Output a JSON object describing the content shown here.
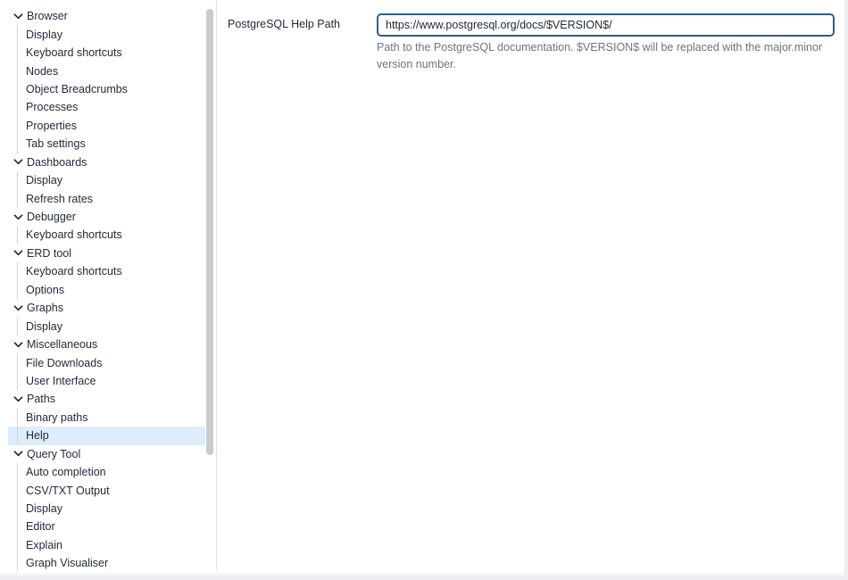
{
  "tree": [
    {
      "label": "Browser",
      "children": [
        "Display",
        "Keyboard shortcuts",
        "Nodes",
        "Object Breadcrumbs",
        "Processes",
        "Properties",
        "Tab settings"
      ]
    },
    {
      "label": "Dashboards",
      "children": [
        "Display",
        "Refresh rates"
      ]
    },
    {
      "label": "Debugger",
      "children": [
        "Keyboard shortcuts"
      ]
    },
    {
      "label": "ERD tool",
      "children": [
        "Keyboard shortcuts",
        "Options"
      ]
    },
    {
      "label": "Graphs",
      "children": [
        "Display"
      ]
    },
    {
      "label": "Miscellaneous",
      "children": [
        "File Downloads",
        "User Interface"
      ]
    },
    {
      "label": "Paths",
      "children": [
        "Binary paths",
        "Help"
      ]
    },
    {
      "label": "Query Tool",
      "children": [
        "Auto completion",
        "CSV/TXT Output",
        "Display",
        "Editor",
        "Explain",
        "Graph Visualiser"
      ]
    }
  ],
  "selected": {
    "group": 6,
    "child": 1
  },
  "form": {
    "label": "PostgreSQL Help Path",
    "value": "https://www.postgresql.org/docs/$VERSION$/",
    "help": "Path to the PostgreSQL documentation. $VERSION$ will be replaced with the major.minor version number."
  },
  "icons": {
    "expand": "chevron-down-icon"
  },
  "colors": {
    "selected_bg": "#dcecfa",
    "input_border": "#2f5c92",
    "help_text": "#6c7380"
  }
}
